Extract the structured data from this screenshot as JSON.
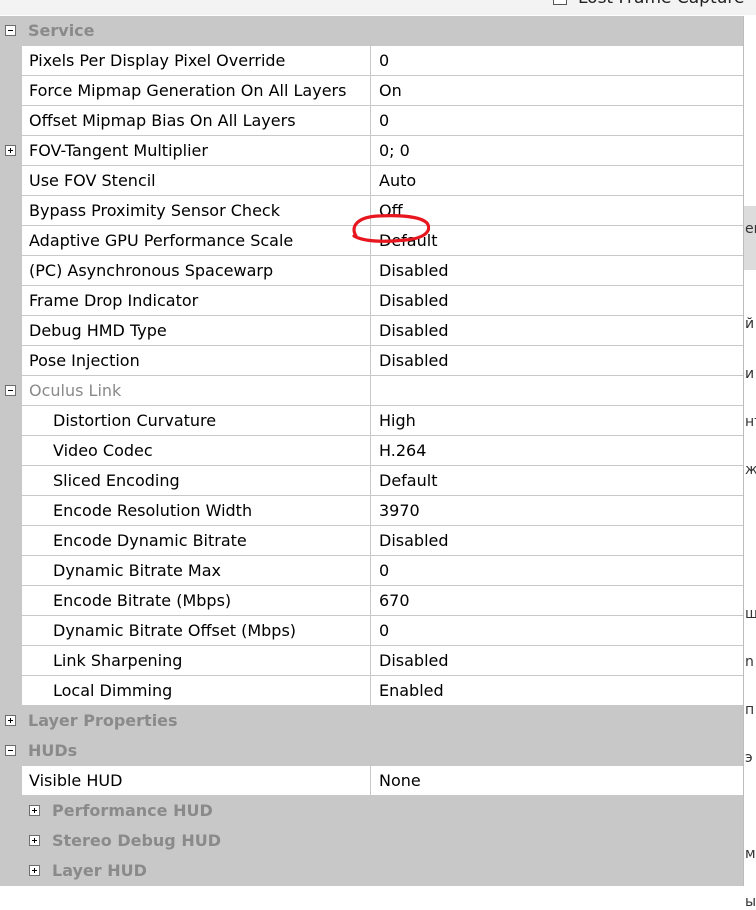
{
  "top": {
    "checkbox_label": "Lost Frame Capture"
  },
  "colors": {
    "category_bg": "#c8c8c8",
    "category_text": "#8a8a8a",
    "annotation": "#e8161e"
  },
  "annotation": {
    "highlights_row": "Bypass Proximity Sensor Check"
  },
  "service": {
    "title": "Service",
    "rows": [
      {
        "name": "Pixels Per Display Pixel Override",
        "value": "0"
      },
      {
        "name": "Force Mipmap Generation On All Layers",
        "value": "On"
      },
      {
        "name": "Offset Mipmap Bias On All Layers",
        "value": "0"
      },
      {
        "name": "FOV-Tangent Multiplier",
        "value": "0; 0"
      },
      {
        "name": "Use FOV Stencil",
        "value": "Auto"
      },
      {
        "name": "Bypass Proximity Sensor Check",
        "value": "Off"
      },
      {
        "name": "Adaptive GPU Performance Scale",
        "value": "Default"
      },
      {
        "name": "(PC) Asynchronous Spacewarp",
        "value": "Disabled"
      },
      {
        "name": "Frame Drop Indicator",
        "value": "Disabled"
      },
      {
        "name": "Debug HMD Type",
        "value": "Disabled"
      },
      {
        "name": "Pose Injection",
        "value": "Disabled"
      }
    ]
  },
  "oculus_link": {
    "title": "Oculus Link",
    "rows": [
      {
        "name": "Distortion Curvature",
        "value": "High"
      },
      {
        "name": "Video Codec",
        "value": "H.264"
      },
      {
        "name": "Sliced Encoding",
        "value": "Default"
      },
      {
        "name": "Encode Resolution Width",
        "value": "3970"
      },
      {
        "name": "Encode Dynamic Bitrate",
        "value": "Disabled"
      },
      {
        "name": "Dynamic Bitrate Max",
        "value": "0"
      },
      {
        "name": "Encode Bitrate (Mbps)",
        "value": "670"
      },
      {
        "name": "Dynamic Bitrate Offset (Mbps)",
        "value": "0"
      },
      {
        "name": "Link Sharpening",
        "value": "Disabled"
      },
      {
        "name": "Local Dimming",
        "value": "Enabled"
      }
    ]
  },
  "layer_properties": {
    "title": "Layer Properties"
  },
  "huds": {
    "title": "HUDs",
    "visible_hud": {
      "name": "Visible HUD",
      "value": "None"
    },
    "sub": [
      "Performance HUD",
      "Stereo Debug HUD",
      "Layer HUD"
    ]
  },
  "side_fragments": [
    "er",
    "й",
    "и",
    "нт",
    "ж",
    "щ",
    "n",
    "п",
    "э",
    "м",
    "ы"
  ]
}
